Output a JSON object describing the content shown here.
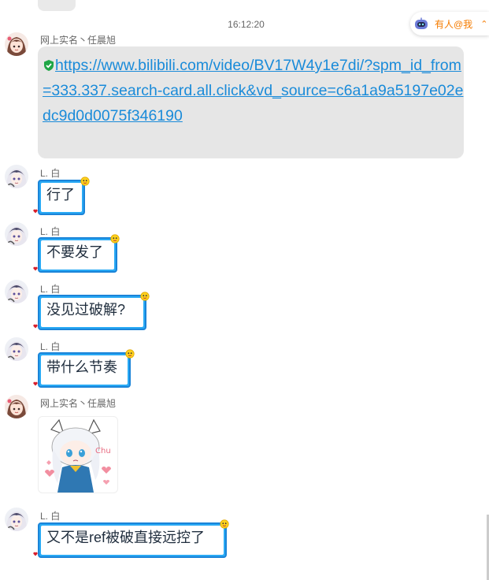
{
  "timestamp": "16:12:20",
  "mention_bar": {
    "label": "有人@我",
    "icon": "robot-icon",
    "chevron": "double-chevron-up-icon",
    "color": "#f57c00"
  },
  "messages": [
    {
      "sender": "网上实名丶任晨旭",
      "type": "link",
      "text": "https://www.bilibili.com/video/BV17W4y1e7di/?spm_id_from=333.337.search-card.all.click&vd_source=c6a1a9a5197e02edc9d0d0075f346190"
    },
    {
      "sender": "L. 白",
      "type": "text",
      "text": "行了"
    },
    {
      "sender": "L. 白",
      "type": "text",
      "text": "不要发了"
    },
    {
      "sender": "L. 白",
      "type": "text",
      "text": "没见过破解?"
    },
    {
      "sender": "L. 白",
      "type": "text",
      "text": "带什么节奏"
    },
    {
      "sender": "网上实名丶任晨旭",
      "type": "sticker",
      "sticker_text": "Chu"
    },
    {
      "sender": "L. 白",
      "type": "text",
      "text": "又不是ref被破直接远控了"
    }
  ],
  "colors": {
    "link": "#1a8bd9",
    "bubble_border": "#1b84d8",
    "bubble_frame": "#29aaf5",
    "verified": "#1fa645"
  }
}
